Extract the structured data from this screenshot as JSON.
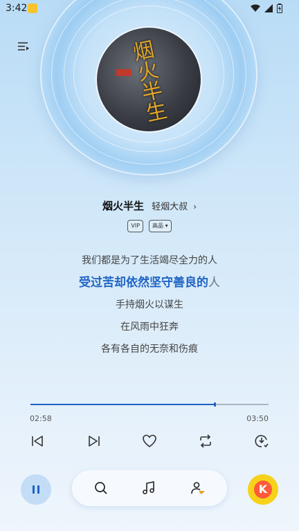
{
  "status_bar": {
    "time": "3:42",
    "icons": [
      "app-notification-icon",
      "wifi-icon",
      "signal-icon",
      "battery-icon"
    ]
  },
  "player": {
    "song_title": "烟火半生",
    "artist": "轻烟大叔",
    "artist_arrow": "›",
    "badges": [
      "VIP",
      "高品 ▾"
    ],
    "album_art_text": "烟火半生",
    "accent_color": "#1e63c4"
  },
  "lyrics": {
    "prev_line": "我们都是为了生活竭尽全力的人",
    "active_line_sung": "受过苦却依然坚守善良的",
    "active_line_rest": "人",
    "next_lines": [
      "手持烟火以谋生",
      "在风雨中狂奔",
      "各有各自的无奈和伤痕"
    ]
  },
  "progress": {
    "current_time": "02:58",
    "total_time": "03:50",
    "fraction": 0.774
  },
  "controls": [
    "previous-icon",
    "next-icon",
    "heart-icon",
    "repeat-icon",
    "download-icon"
  ],
  "bottom_nav": [
    "pause-icon",
    "search-icon",
    "music-note-icon",
    "profile-icon",
    "k-song-icon"
  ]
}
